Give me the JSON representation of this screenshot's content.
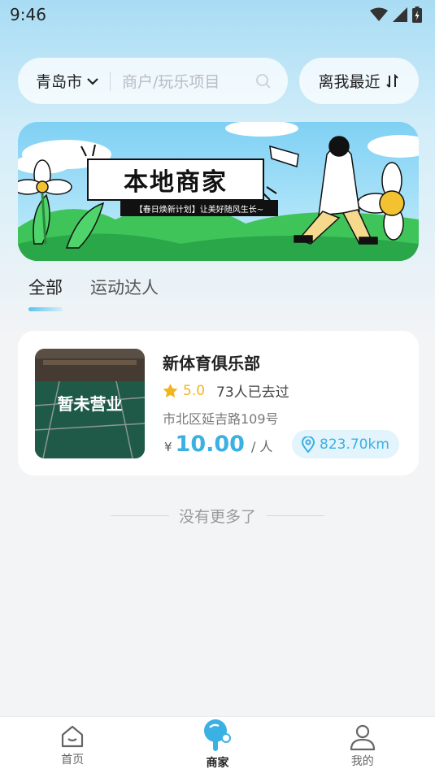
{
  "status_bar": {
    "time": "9:46"
  },
  "search": {
    "city": "青岛市",
    "placeholder": "商户/玩乐项目"
  },
  "sort": {
    "label": "离我最近"
  },
  "banner": {
    "title": "本地商家",
    "subtitle": "【春日焕新计划】让美好随风生长~"
  },
  "tabs": [
    {
      "label": "全部",
      "active": true
    },
    {
      "label": "运动达人",
      "active": false
    }
  ],
  "listing": {
    "name": "新体育俱乐部",
    "thumb_label": "暂未营业",
    "rating": "5.0",
    "visited": "73人已去过",
    "address": "市北区延吉路109号",
    "currency": "¥",
    "price": "10.00",
    "unit": "/ 人",
    "distance": "823.70km"
  },
  "footer": {
    "no_more": "没有更多了"
  },
  "bottom_nav": [
    {
      "label": "首页",
      "icon": "home-icon",
      "active": false
    },
    {
      "label": "商家",
      "icon": "ping-pong-icon",
      "active": true
    },
    {
      "label": "我的",
      "icon": "profile-icon",
      "active": false
    }
  ],
  "colors": {
    "accent": "#3bb0e3",
    "star": "#f2b51e"
  }
}
